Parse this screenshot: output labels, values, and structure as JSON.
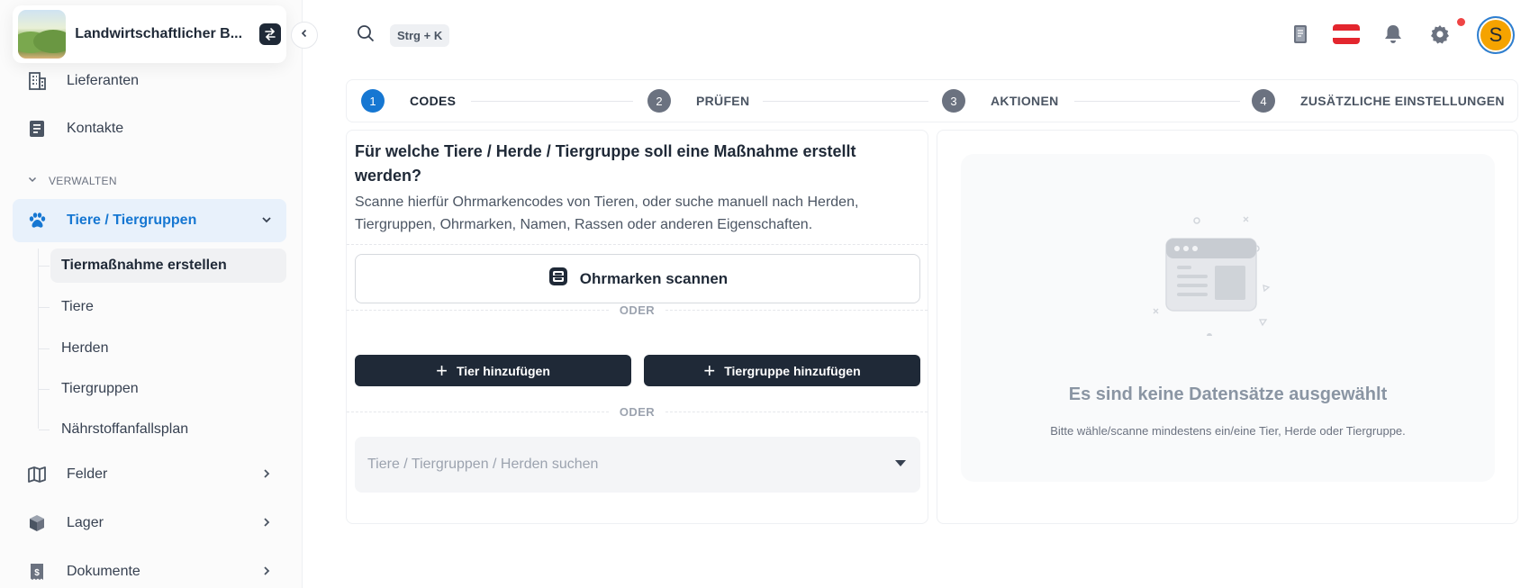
{
  "sidebar": {
    "org_name": "Landwirtschaftlicher B...",
    "items_top": [
      {
        "label": "Lieferanten",
        "icon": "building-icon"
      },
      {
        "label": "Kontakte",
        "icon": "contacts-icon"
      }
    ],
    "section_label": "VERWALTEN",
    "active_item": {
      "label": "Tiere / Tiergruppen",
      "icon": "paw-icon"
    },
    "sub_items": [
      {
        "label": "Tiermaßnahme erstellen"
      },
      {
        "label": "Tiere"
      },
      {
        "label": "Herden"
      },
      {
        "label": "Tiergruppen"
      },
      {
        "label": "Nährstoffanfallsplan"
      }
    ],
    "items_bottom": [
      {
        "label": "Felder",
        "icon": "map-icon"
      },
      {
        "label": "Lager",
        "icon": "box-icon"
      },
      {
        "label": "Dokumente",
        "icon": "document-dollar-icon"
      }
    ]
  },
  "topbar": {
    "shortcut": "Strg + K",
    "avatar_initial": "S",
    "flag_colors": [
      "#e3262e",
      "#ffffff",
      "#e3262e"
    ],
    "notification_dot_color": "#ef4444"
  },
  "stepper": {
    "steps": [
      {
        "num": "1",
        "label": "CODES"
      },
      {
        "num": "2",
        "label": "PRÜFEN"
      },
      {
        "num": "3",
        "label": "AKTIONEN"
      },
      {
        "num": "4",
        "label": "ZUSÄTZLICHE EINSTELLUNGEN"
      }
    ],
    "accent": "#1677d2"
  },
  "main": {
    "question": "Für welche Tiere / Herde / Tiergruppe soll eine Maßnahme erstellt werden?",
    "description": "Scanne hierfür Ohrmarkencodes von Tieren, oder suche manuell nach Herden, Tiergruppen, Ohrmarken, Namen, Rassen oder anderen Eigenschaften.",
    "scan_button": "Ohrmarken scannen",
    "or_label": "ODER",
    "add_animal_button": "Tier hinzufügen",
    "add_group_button": "Tiergruppe hinzufügen",
    "search_placeholder": "Tiere / Tiergruppen / Herden suchen"
  },
  "empty_state": {
    "title": "Es sind keine Datensätze ausgewählt",
    "subtitle": "Bitte wähle/scanne mindestens ein/eine Tier, Herde oder Tiergruppe."
  }
}
